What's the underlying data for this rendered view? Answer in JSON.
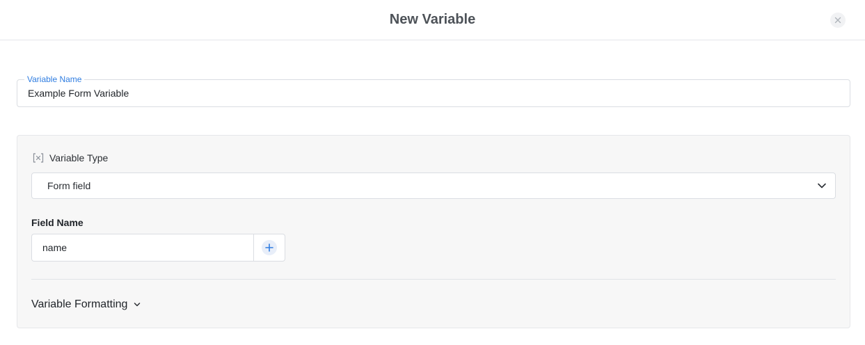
{
  "dialog": {
    "title": "New Variable"
  },
  "variable_name": {
    "label": "Variable Name",
    "value": "Example Form Variable"
  },
  "variable_type": {
    "icon": "variable-bracket-icon",
    "label": "Variable Type",
    "selected": "Form field"
  },
  "field_name": {
    "label": "Field Name",
    "value": "name"
  },
  "formatting": {
    "label": "Variable Formatting"
  },
  "colors": {
    "accent": "#2f7de1",
    "panel_bg": "#f7f7f7",
    "border": "#dadde2"
  }
}
